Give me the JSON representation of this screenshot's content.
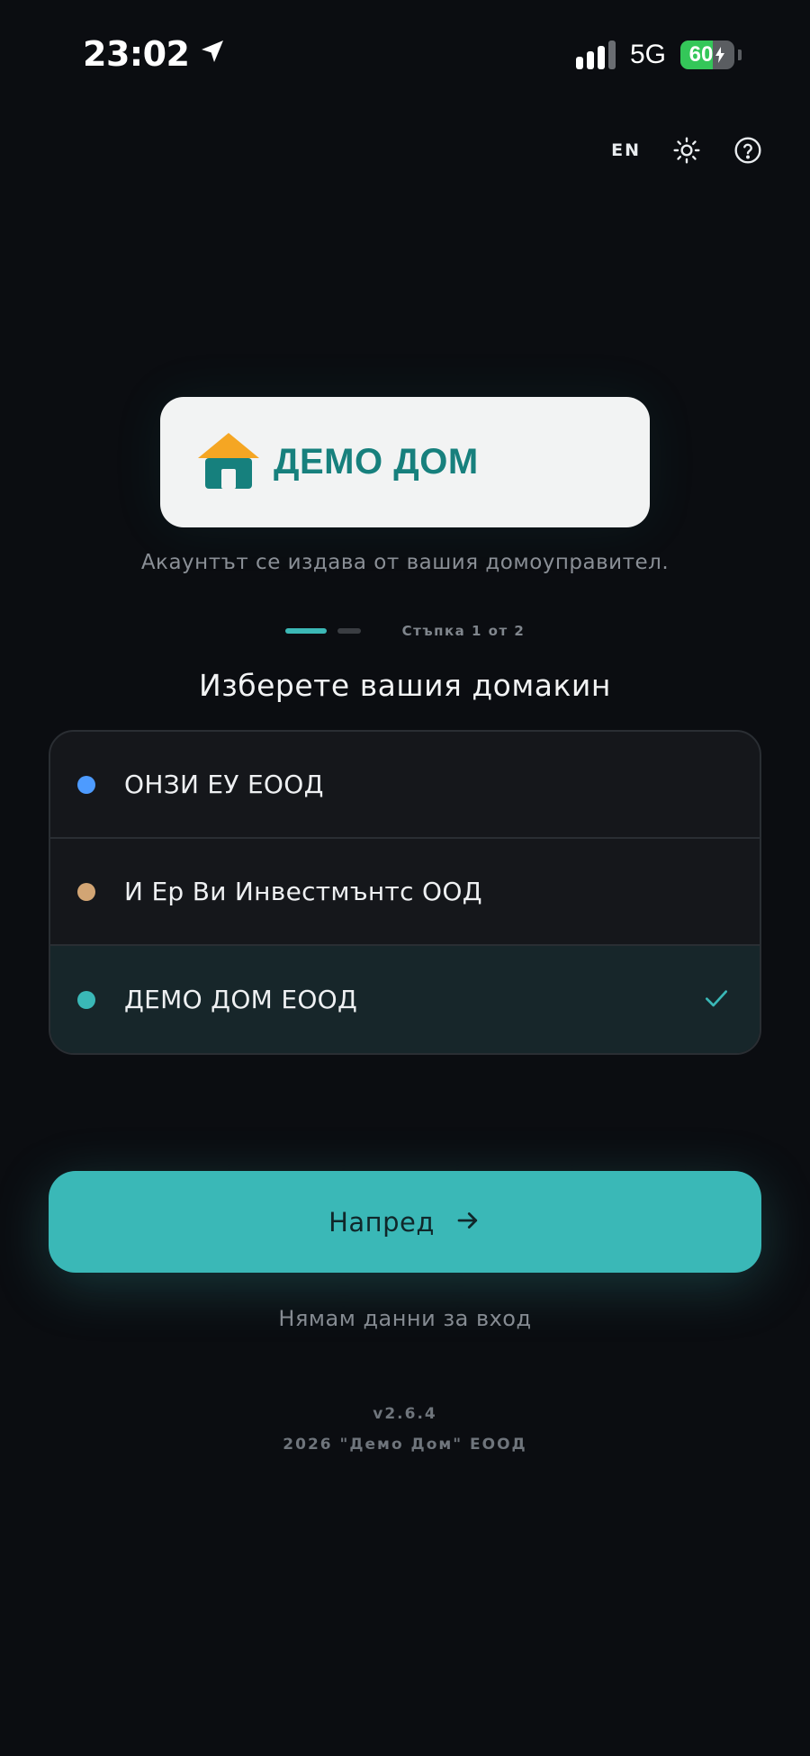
{
  "status_bar": {
    "time": "23:02",
    "network": "5G",
    "battery": "60",
    "battery_level": 0.6
  },
  "top_controls": {
    "language": "EN",
    "theme_icon": "sun-icon",
    "help_icon": "help-circle-icon"
  },
  "logo": {
    "text": "ДЕМО ДОМ",
    "icon": "house-icon",
    "roof_color": "#f5a623",
    "house_color": "#16807d"
  },
  "tagline": "Акаунтът се издава от вашия домоуправител.",
  "stepper": {
    "label": "Стъпка 1 от 2",
    "current_step": 1,
    "total_steps": 2
  },
  "section_title": "Изберете вашия домакин",
  "hosts": [
    {
      "label": "ОНЗИ ЕУ ЕООД",
      "color": "#4d9bff",
      "selected": false
    },
    {
      "label": "И Ер Ви Инвестмънтс ООД",
      "color": "#d2a574",
      "selected": false
    },
    {
      "label": "ДЕМО ДОМ ЕООД",
      "color": "#3ab8b7",
      "selected": true
    }
  ],
  "next_button": {
    "label": "Напред",
    "icon": "arrow-right-icon",
    "color": "#3ab8b7"
  },
  "no_login_link": "Нямам данни за вход",
  "footer": {
    "version": "v2.6.4",
    "copyright": "2026 \"Демо Дом\" ЕООД"
  }
}
